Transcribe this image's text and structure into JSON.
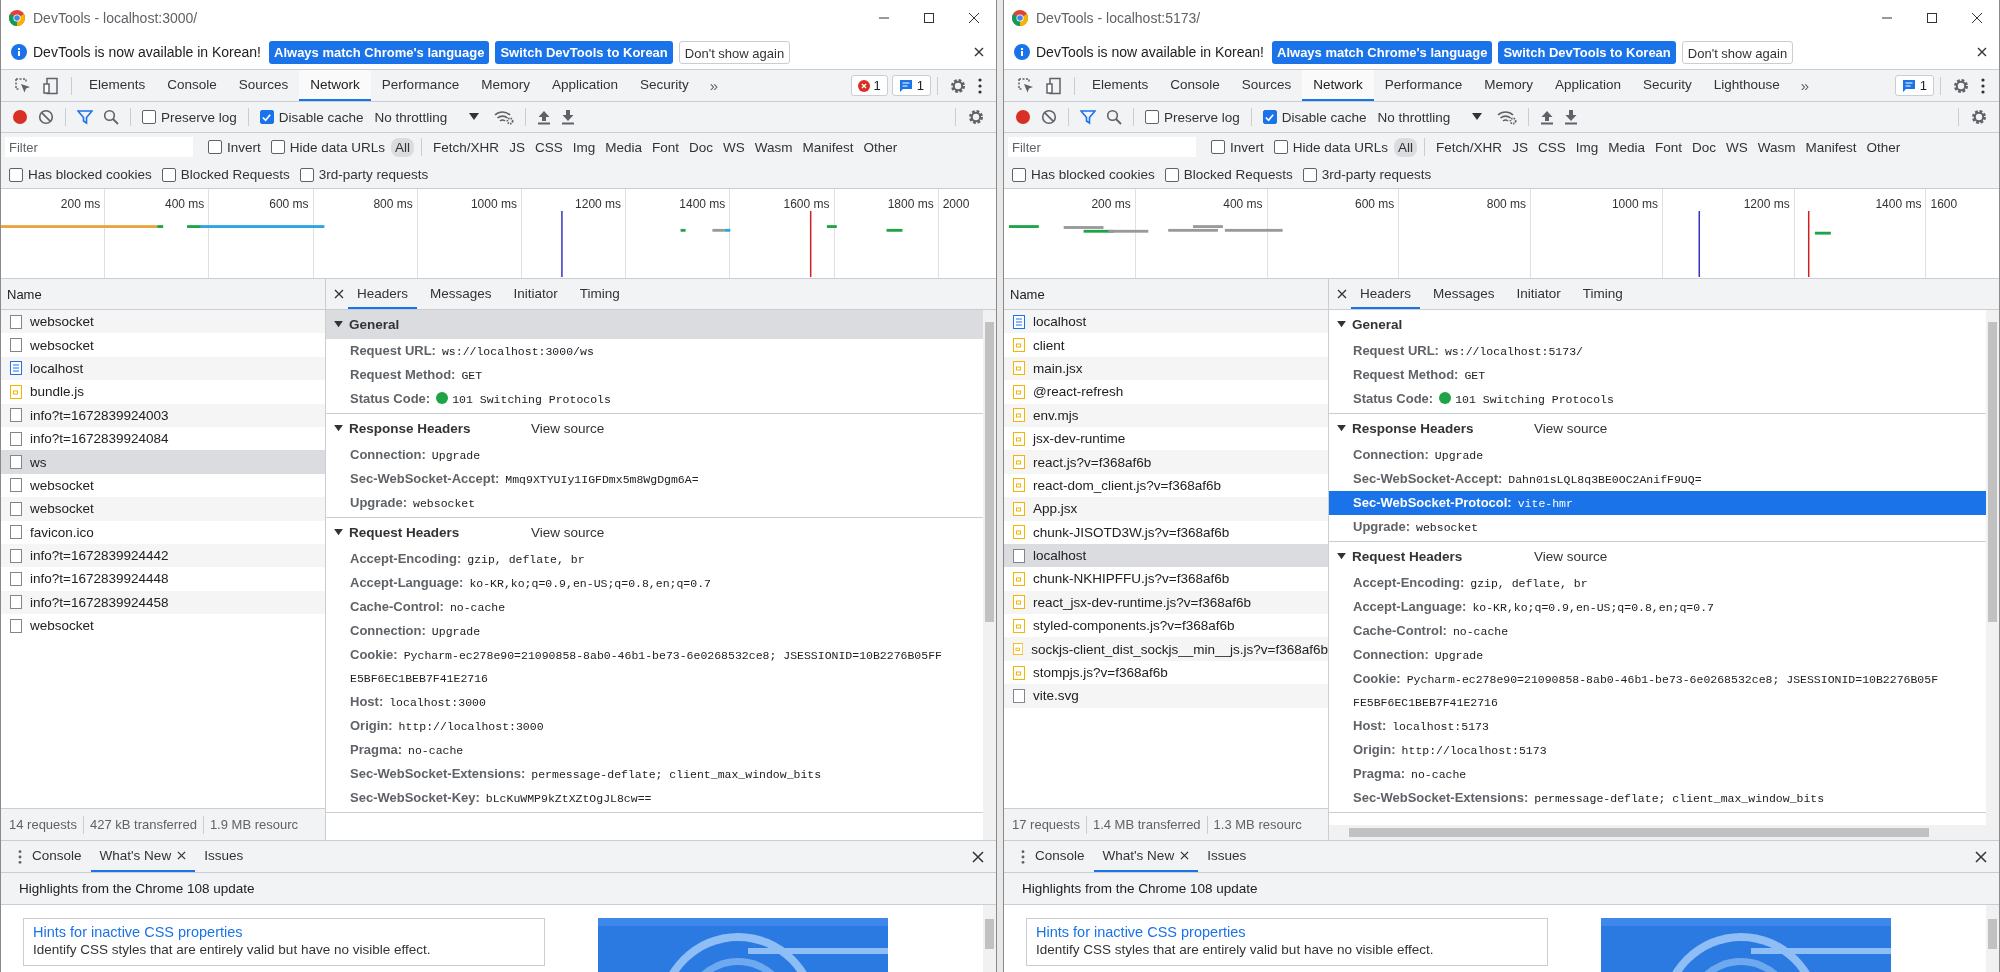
{
  "windows": [
    {
      "title": "DevTools - localhost:3000/",
      "infobar": {
        "message": "DevTools is now available in Korean!",
        "buttons": [
          {
            "label": "Always match Chrome's language",
            "kind": "primary"
          },
          {
            "label": "Switch DevTools to Korean",
            "kind": "primary"
          },
          {
            "label": "Don't show again",
            "kind": "secondary"
          }
        ]
      },
      "panel_tabs": [
        {
          "label": "Elements",
          "selected": false
        },
        {
          "label": "Console",
          "selected": false
        },
        {
          "label": "Sources",
          "selected": false
        },
        {
          "label": "Network",
          "selected": true
        },
        {
          "label": "Performance",
          "selected": false
        },
        {
          "label": "Memory",
          "selected": false
        },
        {
          "label": "Application",
          "selected": false
        },
        {
          "label": "Security",
          "selected": false
        }
      ],
      "more_tabs": "»",
      "badges": [
        {
          "kind": "error",
          "count": "1"
        },
        {
          "kind": "message",
          "count": "1"
        }
      ],
      "toolbar": {
        "preserve_log": {
          "label": "Preserve log",
          "checked": false
        },
        "disable_cache": {
          "label": "Disable cache",
          "checked": true
        },
        "throttling": "No throttling"
      },
      "filter": {
        "placeholder": "Filter",
        "checks": [
          {
            "label": "Invert",
            "checked": false
          },
          {
            "label": "Hide data URLs",
            "checked": false
          }
        ],
        "types": [
          {
            "label": "All",
            "selected": true
          },
          {
            "label": "Fetch/XHR",
            "selected": false
          },
          {
            "label": "JS",
            "selected": false
          },
          {
            "label": "CSS",
            "selected": false
          },
          {
            "label": "Img",
            "selected": false
          },
          {
            "label": "Media",
            "selected": false
          },
          {
            "label": "Font",
            "selected": false
          },
          {
            "label": "Doc",
            "selected": false
          },
          {
            "label": "WS",
            "selected": false
          },
          {
            "label": "Wasm",
            "selected": false
          },
          {
            "label": "Manifest",
            "selected": false
          },
          {
            "label": "Other",
            "selected": false
          }
        ],
        "options": [
          {
            "label": "Has blocked cookies",
            "checked": false
          },
          {
            "label": "Blocked Requests",
            "checked": false
          },
          {
            "label": "3rd-party requests",
            "checked": false
          }
        ]
      },
      "overview": {
        "ticks": [
          "200 ms",
          "400 ms",
          "600 ms",
          "800 ms",
          "1000 ms",
          "1200 ms",
          "1400 ms",
          "1600 ms",
          "1800 ms",
          "2000"
        ]
      },
      "requests": {
        "column": "Name",
        "rows": [
          {
            "name": "websocket",
            "kind": "other",
            "selected": false
          },
          {
            "name": "websocket",
            "kind": "other",
            "selected": false
          },
          {
            "name": "localhost",
            "kind": "document",
            "selected": false
          },
          {
            "name": "bundle.js",
            "kind": "script",
            "selected": false
          },
          {
            "name": "info?t=1672839924003",
            "kind": "other",
            "selected": false
          },
          {
            "name": "info?t=1672839924084",
            "kind": "other",
            "selected": false
          },
          {
            "name": "ws",
            "kind": "other",
            "selected": true
          },
          {
            "name": "websocket",
            "kind": "other",
            "selected": false
          },
          {
            "name": "websocket",
            "kind": "other",
            "selected": false
          },
          {
            "name": "favicon.ico",
            "kind": "other",
            "selected": false
          },
          {
            "name": "info?t=1672839924442",
            "kind": "other",
            "selected": false
          },
          {
            "name": "info?t=1672839924448",
            "kind": "other",
            "selected": false
          },
          {
            "name": "info?t=1672839924458",
            "kind": "other",
            "selected": false
          },
          {
            "name": "websocket",
            "kind": "other",
            "selected": false
          }
        ]
      },
      "status_bar": [
        "14 requests",
        "427 kB transferred",
        "1.9 MB resourc"
      ],
      "detail": {
        "h_scrollbar": false,
        "tabs": [
          {
            "label": "Headers",
            "selected": true
          },
          {
            "label": "Messages",
            "selected": false
          },
          {
            "label": "Initiator",
            "selected": false
          },
          {
            "label": "Timing",
            "selected": false
          }
        ],
        "sections": [
          {
            "title": "General",
            "selected": true,
            "rows": [
              {
                "name": "Request URL:",
                "value": "ws://localhost:3000/ws",
                "kind": "plain",
                "selected": false
              },
              {
                "name": "Request Method:",
                "value": "GET",
                "kind": "plain",
                "selected": false
              },
              {
                "name": "Status Code:",
                "value": "101 Switching Protocols",
                "kind": "status",
                "selected": false
              }
            ]
          },
          {
            "title": "Response Headers",
            "selected": false,
            "link": "View source",
            "rows": [
              {
                "name": "Connection:",
                "value": "Upgrade",
                "kind": "plain",
                "selected": false
              },
              {
                "name": "Sec-WebSocket-Accept:",
                "value": "Mmq9XTYUIy1IGFDmx5m8WgDgm6A=",
                "kind": "plain",
                "selected": false
              },
              {
                "name": "Upgrade:",
                "value": "websocket",
                "kind": "plain",
                "selected": false
              }
            ]
          },
          {
            "title": "Request Headers",
            "selected": false,
            "link": "View source",
            "rows": [
              {
                "name": "Accept-Encoding:",
                "value": "gzip, deflate, br",
                "kind": "plain",
                "selected": false
              },
              {
                "name": "Accept-Language:",
                "value": "ko-KR,ko;q=0.9,en-US;q=0.8,en;q=0.7",
                "kind": "plain",
                "selected": false
              },
              {
                "name": "Cache-Control:",
                "value": "no-cache",
                "kind": "plain",
                "selected": false
              },
              {
                "name": "Connection:",
                "value": "Upgrade",
                "kind": "plain",
                "selected": false
              },
              {
                "name": "Cookie:",
                "value": "Pycharm-ec278e90=21090858-8ab0-46b1-be73-6e0268532ce8; JSESSIONID=10B2276B05FF",
                "continuation": "E5BF6EC1BEB7F41E2716",
                "kind": "wrapped",
                "selected": false
              },
              {
                "name": "Host:",
                "value": "localhost:3000",
                "kind": "plain",
                "selected": false
              },
              {
                "name": "Origin:",
                "value": "http://localhost:3000",
                "kind": "plain",
                "selected": false
              },
              {
                "name": "Pragma:",
                "value": "no-cache",
                "kind": "plain",
                "selected": false
              },
              {
                "name": "Sec-WebSocket-Extensions:",
                "value": "permessage-deflate; client_max_window_bits",
                "kind": "plain",
                "selected": false
              },
              {
                "name": "Sec-WebSocket-Key:",
                "value": "bLcKuWMP9kZtXZtOgJL8cw==",
                "kind": "plain",
                "selected": false
              }
            ]
          }
        ]
      },
      "drawer": {
        "tabs": [
          {
            "label": "Console",
            "selected": false,
            "closable": false
          },
          {
            "label": "What's New",
            "selected": true,
            "closable": true
          },
          {
            "label": "Issues",
            "selected": false,
            "closable": false
          }
        ],
        "heading": "Highlights from the Chrome 108 update",
        "card": {
          "link": "Hints for inactive CSS properties",
          "description": "Identify CSS styles that are entirely valid but have no visible effect."
        }
      }
    },
    {
      "title": "DevTools - localhost:5173/",
      "infobar": {
        "message": "DevTools is now available in Korean!",
        "buttons": [
          {
            "label": "Always match Chrome's language",
            "kind": "primary"
          },
          {
            "label": "Switch DevTools to Korean",
            "kind": "primary"
          },
          {
            "label": "Don't show again",
            "kind": "secondary"
          }
        ]
      },
      "panel_tabs": [
        {
          "label": "Elements",
          "selected": false
        },
        {
          "label": "Console",
          "selected": false
        },
        {
          "label": "Sources",
          "selected": false
        },
        {
          "label": "Network",
          "selected": true
        },
        {
          "label": "Performance",
          "selected": false
        },
        {
          "label": "Memory",
          "selected": false
        },
        {
          "label": "Application",
          "selected": false
        },
        {
          "label": "Security",
          "selected": false
        },
        {
          "label": "Lighthouse",
          "selected": false
        }
      ],
      "more_tabs": "»",
      "badges": [
        {
          "kind": "message",
          "count": "1"
        }
      ],
      "toolbar": {
        "preserve_log": {
          "label": "Preserve log",
          "checked": false
        },
        "disable_cache": {
          "label": "Disable cache",
          "checked": true
        },
        "throttling": "No throttling"
      },
      "filter": {
        "placeholder": "Filter",
        "checks": [
          {
            "label": "Invert",
            "checked": false
          },
          {
            "label": "Hide data URLs",
            "checked": false
          }
        ],
        "types": [
          {
            "label": "All",
            "selected": true
          },
          {
            "label": "Fetch/XHR",
            "selected": false
          },
          {
            "label": "JS",
            "selected": false
          },
          {
            "label": "CSS",
            "selected": false
          },
          {
            "label": "Img",
            "selected": false
          },
          {
            "label": "Media",
            "selected": false
          },
          {
            "label": "Font",
            "selected": false
          },
          {
            "label": "Doc",
            "selected": false
          },
          {
            "label": "WS",
            "selected": false
          },
          {
            "label": "Wasm",
            "selected": false
          },
          {
            "label": "Manifest",
            "selected": false
          },
          {
            "label": "Other",
            "selected": false
          }
        ],
        "options": [
          {
            "label": "Has blocked cookies",
            "checked": false
          },
          {
            "label": "Blocked Requests",
            "checked": false
          },
          {
            "label": "3rd-party requests",
            "checked": false
          }
        ]
      },
      "overview": {
        "ticks": [
          "200 ms",
          "400 ms",
          "600 ms",
          "800 ms",
          "1000 ms",
          "1200 ms",
          "1400 ms",
          "1600"
        ]
      },
      "requests": {
        "column": "Name",
        "rows": [
          {
            "name": "localhost",
            "kind": "document",
            "selected": false
          },
          {
            "name": "client",
            "kind": "script",
            "selected": false
          },
          {
            "name": "main.jsx",
            "kind": "script",
            "selected": false
          },
          {
            "name": "@react-refresh",
            "kind": "script",
            "selected": false
          },
          {
            "name": "env.mjs",
            "kind": "script",
            "selected": false
          },
          {
            "name": "jsx-dev-runtime",
            "kind": "script",
            "selected": false
          },
          {
            "name": "react.js?v=f368af6b",
            "kind": "script",
            "selected": false
          },
          {
            "name": "react-dom_client.js?v=f368af6b",
            "kind": "script",
            "selected": false
          },
          {
            "name": "App.jsx",
            "kind": "script",
            "selected": false
          },
          {
            "name": "chunk-JISOTD3W.js?v=f368af6b",
            "kind": "script",
            "selected": false
          },
          {
            "name": "localhost",
            "kind": "other",
            "selected": true
          },
          {
            "name": "chunk-NKHIPFFU.js?v=f368af6b",
            "kind": "script",
            "selected": false
          },
          {
            "name": "react_jsx-dev-runtime.js?v=f368af6b",
            "kind": "script",
            "selected": false
          },
          {
            "name": "styled-components.js?v=f368af6b",
            "kind": "script",
            "selected": false
          },
          {
            "name": "sockjs-client_dist_sockjs__min__js.js?v=f368af6b",
            "kind": "script",
            "selected": false
          },
          {
            "name": "stompjs.js?v=f368af6b",
            "kind": "script",
            "selected": false
          },
          {
            "name": "vite.svg",
            "kind": "other",
            "selected": false
          }
        ]
      },
      "status_bar": [
        "17 requests",
        "1.4 MB transferred",
        "1.3 MB resourc"
      ],
      "detail": {
        "h_scrollbar": true,
        "tabs": [
          {
            "label": "Headers",
            "selected": true
          },
          {
            "label": "Messages",
            "selected": false
          },
          {
            "label": "Initiator",
            "selected": false
          },
          {
            "label": "Timing",
            "selected": false
          }
        ],
        "sections": [
          {
            "title": "General",
            "selected": false,
            "rows": [
              {
                "name": "Request URL:",
                "value": "ws://localhost:5173/",
                "kind": "plain",
                "selected": false
              },
              {
                "name": "Request Method:",
                "value": "GET",
                "kind": "plain",
                "selected": false
              },
              {
                "name": "Status Code:",
                "value": "101 Switching Protocols",
                "kind": "status",
                "selected": false
              }
            ]
          },
          {
            "title": "Response Headers",
            "selected": false,
            "link": "View source",
            "rows": [
              {
                "name": "Connection:",
                "value": "Upgrade",
                "kind": "plain",
                "selected": false
              },
              {
                "name": "Sec-WebSocket-Accept:",
                "value": "Dahn01sLQL8q3BE0OC2AnifF9UQ=",
                "kind": "plain",
                "selected": false
              },
              {
                "name": "Sec-WebSocket-Protocol:",
                "value": "vite-hmr",
                "kind": "plain",
                "selected": true
              },
              {
                "name": "Upgrade:",
                "value": "websocket",
                "kind": "plain",
                "selected": false
              }
            ]
          },
          {
            "title": "Request Headers",
            "selected": false,
            "link": "View source",
            "rows": [
              {
                "name": "Accept-Encoding:",
                "value": "gzip, deflate, br",
                "kind": "plain",
                "selected": false
              },
              {
                "name": "Accept-Language:",
                "value": "ko-KR,ko;q=0.9,en-US;q=0.8,en;q=0.7",
                "kind": "plain",
                "selected": false
              },
              {
                "name": "Cache-Control:",
                "value": "no-cache",
                "kind": "plain",
                "selected": false
              },
              {
                "name": "Connection:",
                "value": "Upgrade",
                "kind": "plain",
                "selected": false
              },
              {
                "name": "Cookie:",
                "value": "Pycharm-ec278e90=21090858-8ab0-46b1-be73-6e0268532ce8; JSESSIONID=10B2276B05F",
                "continuation": "FE5BF6EC1BEB7F41E2716",
                "kind": "wrapped",
                "selected": false
              },
              {
                "name": "Host:",
                "value": "localhost:5173",
                "kind": "plain",
                "selected": false
              },
              {
                "name": "Origin:",
                "value": "http://localhost:5173",
                "kind": "plain",
                "selected": false
              },
              {
                "name": "Pragma:",
                "value": "no-cache",
                "kind": "plain",
                "selected": false
              },
              {
                "name": "Sec-WebSocket-Extensions:",
                "value": "permessage-deflate; client_max_window_bits",
                "kind": "plain",
                "selected": false
              }
            ]
          }
        ]
      },
      "drawer": {
        "tabs": [
          {
            "label": "Console",
            "selected": false,
            "closable": false
          },
          {
            "label": "What's New",
            "selected": true,
            "closable": true
          },
          {
            "label": "Issues",
            "selected": false,
            "closable": false
          }
        ],
        "heading": "Highlights from the Chrome 108 update",
        "card": {
          "link": "Hints for inactive CSS properties",
          "description": "Identify CSS styles that are entirely valid but have no visible effect."
        }
      }
    }
  ]
}
